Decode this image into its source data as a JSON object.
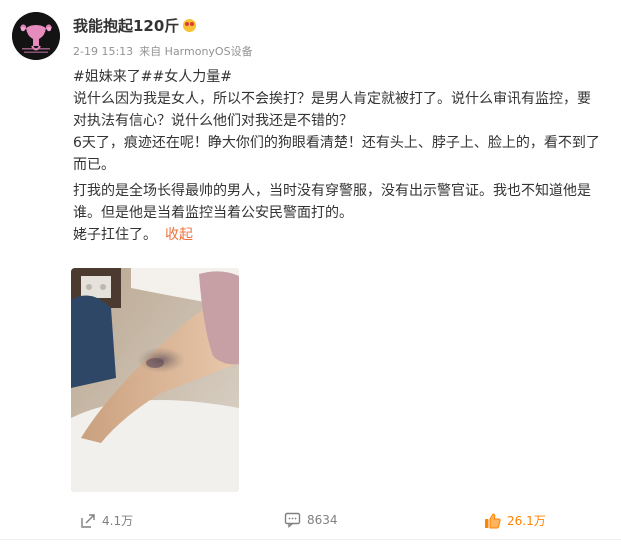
{
  "user": {
    "name": "我能抱起120斤"
  },
  "meta": {
    "time": "2-19 15:13",
    "source": "来自 HarmonyOS设备"
  },
  "post": {
    "hashtags": "#姐妹来了##女人力量#",
    "lines": [
      "说什么因为我是女人，所以不会挨打？是男人肯定就被打了。说什么审讯有监控，要对执法有信心？说什么他们对我还是不错的？",
      "6天了，痕迹还在呢！睁大你们的狗眼看清楚！还有头上、脖子上、脸上的，看不到了而已。",
      "打我的是全场长得最帅的男人，当时没有穿警服，没有出示警官证。我也不知道他是谁。但是他是当着监控当着公安民警面打的。",
      "姥子扛住了。"
    ],
    "collapse_label": "收起"
  },
  "actions": {
    "repost": "4.1万",
    "comment": "8634",
    "like": "26.1万"
  },
  "colors": {
    "accent": "#eb7340",
    "liked": "#ff8200",
    "meta": "#939393"
  }
}
